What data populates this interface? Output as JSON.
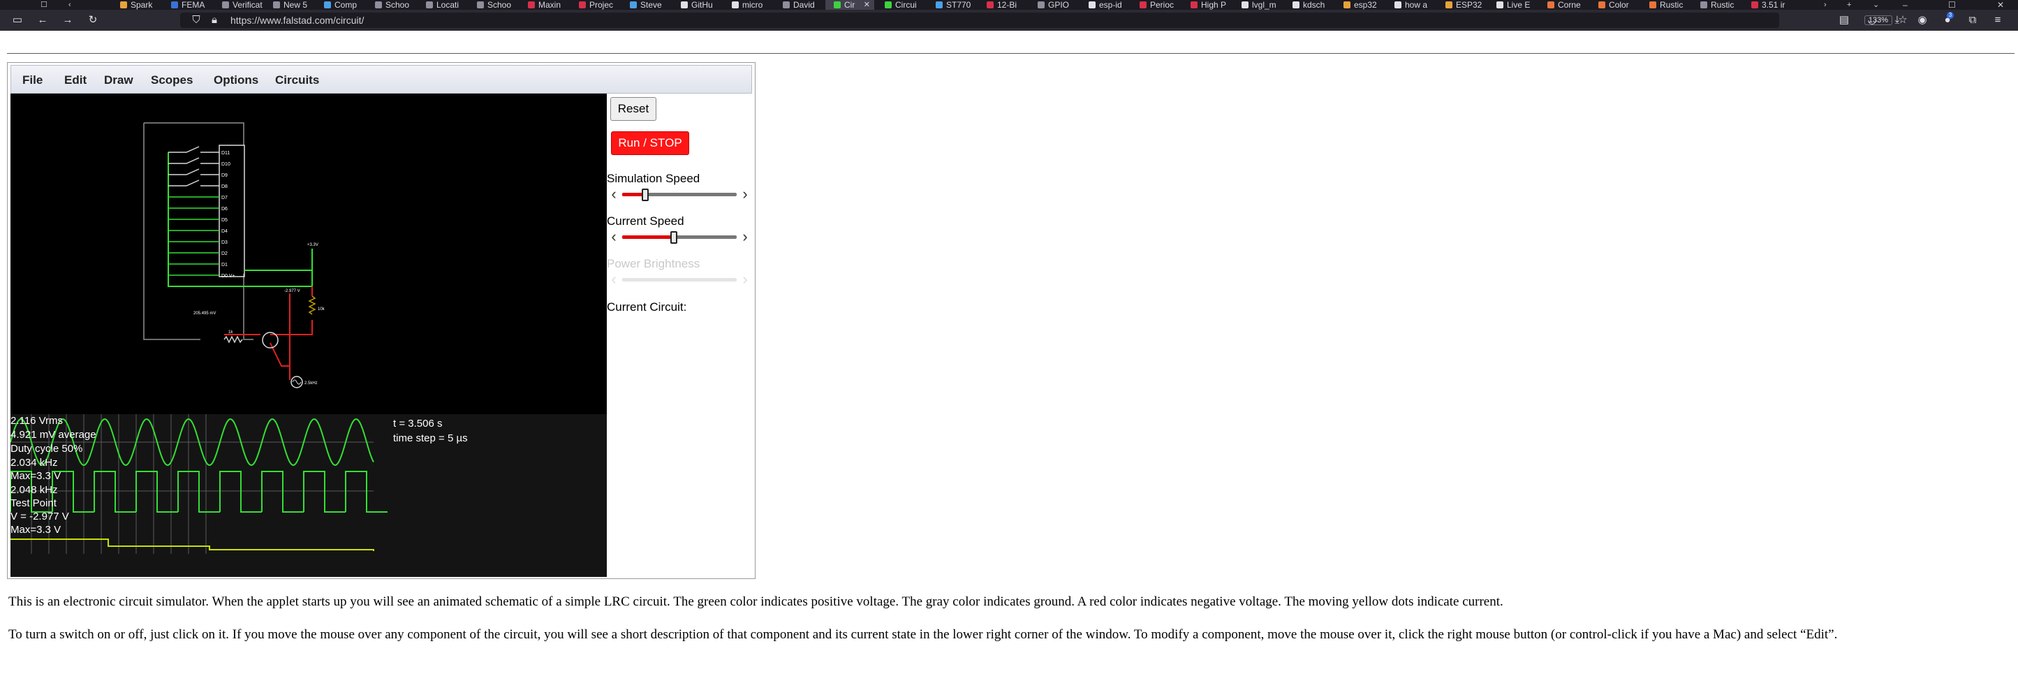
{
  "browser": {
    "tabs": [
      {
        "label": "Spark",
        "color": "#e8a33a"
      },
      {
        "label": "FEMA",
        "color": "#3a72d8"
      },
      {
        "label": "Verificatio",
        "color": "#8f8f9d"
      },
      {
        "label": "New 5",
        "color": "#8f8f9d"
      },
      {
        "label": "Comp",
        "color": "#4ca0e8"
      },
      {
        "label": "Schoo",
        "color": "#8f8f9d"
      },
      {
        "label": "Locati",
        "color": "#8f8f9d"
      },
      {
        "label": "Schoo",
        "color": "#8f8f9d"
      },
      {
        "label": "Maxin",
        "color": "#d8304a"
      },
      {
        "label": "Projec",
        "color": "#d8304a"
      },
      {
        "label": "Steve",
        "color": "#4ca0e8"
      },
      {
        "label": "GitHu",
        "color": "#e0e0e6"
      },
      {
        "label": "micro",
        "color": "#e0e0e6"
      },
      {
        "label": "David",
        "color": "#8f8f9d"
      },
      {
        "label": "Cir",
        "color": "#3fd23f",
        "active": true
      },
      {
        "label": "Circui",
        "color": "#3fd23f"
      },
      {
        "label": "ST770",
        "color": "#4ca0e8"
      },
      {
        "label": "12-Bi",
        "color": "#d8304a"
      },
      {
        "label": "GPIO",
        "color": "#8f8f9d"
      },
      {
        "label": "esp-id",
        "color": "#e0e0e6"
      },
      {
        "label": "Perioc",
        "color": "#d8304a"
      },
      {
        "label": "High P",
        "color": "#d8304a"
      },
      {
        "label": "lvgl_m",
        "color": "#e0e0e6"
      },
      {
        "label": "kdsch",
        "color": "#e0e0e6"
      },
      {
        "label": "esp32",
        "color": "#e8a33a"
      },
      {
        "label": "how a",
        "color": "#e0e0e6"
      },
      {
        "label": "ESP32",
        "color": "#e8a33a"
      },
      {
        "label": "Live E",
        "color": "#e0e0e6"
      },
      {
        "label": "Corne",
        "color": "#e8753a"
      },
      {
        "label": "Color",
        "color": "#e8753a"
      },
      {
        "label": "Rustic",
        "color": "#e8753a"
      },
      {
        "label": "Rustic",
        "color": "#8f8f9d"
      },
      {
        "label": "3.51 ir",
        "color": "#d8304a"
      }
    ],
    "url": "https://www.falstad.com/circuit/",
    "zoom": "133%",
    "notification_count": "3"
  },
  "menu": {
    "items": [
      "File",
      "Edit",
      "Draw",
      "Scopes",
      "Options",
      "Circuits"
    ]
  },
  "controls": {
    "reset_label": "Reset",
    "run_label": "Run / STOP",
    "sim_speed_label": "Simulation Speed",
    "sim_speed_value": 0.2,
    "current_speed_label": "Current Speed",
    "current_speed_value": 0.45,
    "power_brightness_label": "Power Brightness",
    "current_circuit_label": "Current Circuit:"
  },
  "circuit": {
    "pins": [
      "D11",
      "D10",
      "D9",
      "D8",
      "D7",
      "D6",
      "D5",
      "D4",
      "D3",
      "D2",
      "D1",
      "D0 V+"
    ],
    "labels": {
      "vcc": "+3.3V",
      "node_voltage": "-2.977 V",
      "resistor": "10k",
      "left_voltage": "205.495 mV",
      "base_resistor": "1k",
      "source": "2.5kHz"
    }
  },
  "scope": {
    "readouts": [
      "2.116 Vrms",
      "4.921 mV average",
      "Duty cycle 50%",
      "2.034 kHz",
      "Max=3.3 V",
      "2.048 kHz",
      "Test Point",
      "V = -2.977 V",
      "Max=3.3 V"
    ],
    "time": "t = 3.506 s",
    "time_step": "time step = 5 µs",
    "colors": {
      "trace": "#33e033",
      "grid": "#5a5a5a"
    }
  },
  "description": {
    "paragraph1": "This is an electronic circuit simulator.  When the applet starts up you will see an animated schematic of a simple LRC circuit. The green color indicates positive voltage.  The gray color indicates ground.  A red color indicates negative voltage.  The moving yellow dots indicate current.",
    "paragraph2": "To turn a switch on or off, just click on it.  If you move the mouse over any component of the circuit, you will see a short description of that component and its current state in the lower right corner of the window.  To modify a component, move the mouse over it, click the right mouse button (or control-click if you have a Mac) and select “Edit”."
  }
}
